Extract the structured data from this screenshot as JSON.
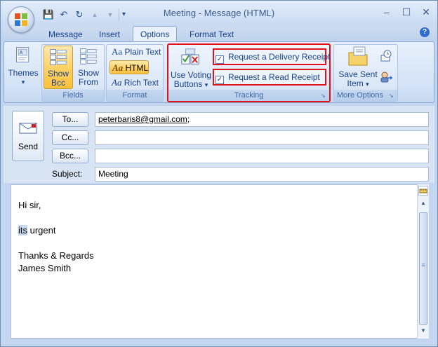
{
  "window": {
    "title": "Meeting - Message (HTML)",
    "controls": {
      "minimize": "–",
      "maximize": "☐",
      "close": "✕"
    }
  },
  "qat": {
    "save": "💾",
    "undo": "↶",
    "redo": "↻",
    "up": "▲",
    "down": "▼",
    "more": "▾"
  },
  "tabs": [
    {
      "label": "Message"
    },
    {
      "label": "Insert"
    },
    {
      "label": "Options"
    },
    {
      "label": "Format Text"
    }
  ],
  "active_tab": "Options",
  "help": "?",
  "ribbon": {
    "themes": {
      "label": "Themes",
      "arrow": "▾"
    },
    "fields": {
      "group_label": "Fields",
      "show_bcc": {
        "line1": "Show",
        "line2": "Bcc"
      },
      "show_from": {
        "line1": "Show",
        "line2": "From"
      }
    },
    "format": {
      "group_label": "Format",
      "plain_text": "Plain Text",
      "html": "HTML",
      "rich_text": "Rich Text",
      "aa": "Aa"
    },
    "tracking": {
      "group_label": "Tracking",
      "voting": {
        "line1": "Use Voting",
        "line2": "Buttons",
        "arrow": "▾"
      },
      "delivery_receipt": "Request a Delivery Receipt",
      "read_receipt": "Request a Read Receipt",
      "check": "✓"
    },
    "more_options": {
      "group_label": "More Options",
      "save_sent": {
        "line1": "Save Sent",
        "line2": "Item",
        "arrow": "▾"
      }
    },
    "launcher": "↘"
  },
  "form": {
    "send": "Send",
    "to_button": "To...",
    "cc_button": "Cc...",
    "bcc_button": "Bcc...",
    "to_value": "peterbaris8@gmail.com",
    "to_suffix": ";",
    "cc_value": "",
    "bcc_value": "",
    "subject_label": "Subject:",
    "subject_value": "Meeting"
  },
  "body": {
    "line1": "Hi sir,",
    "line2_highlight": "its",
    "line2_rest": " urgent",
    "line3": "Thanks & Regards",
    "line4": "James Smith"
  },
  "scrollbar": {
    "up": "▲",
    "down": "▼",
    "grip": "≡"
  },
  "colors": {
    "accent_red": "#e0101c",
    "selected": "#ffd36a",
    "link": "#0000ee"
  }
}
